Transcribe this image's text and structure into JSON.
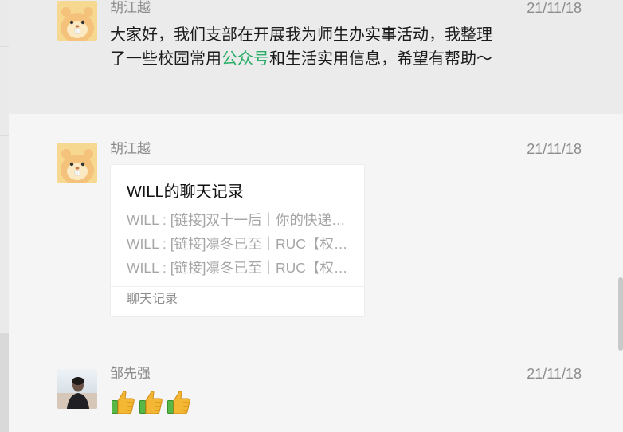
{
  "messages": [
    {
      "sender": "胡江越",
      "time": "21/11/18",
      "avatar": "hamster-avatar",
      "text_parts": [
        "大家好，我们支部在开展我为师生办实事活动，我整理了一些校园常用",
        "公众号",
        "和生活实用信息，希望有帮助～"
      ]
    },
    {
      "sender": "胡江越",
      "time": "21/11/18",
      "avatar": "hamster-avatar",
      "card": {
        "title": "WILL的聊天记录",
        "lines": [
          "WILL : [链接]双十一后｜你的快递…",
          "WILL : [链接]凛冬已至｜RUC【权…",
          "WILL : [链接]凛冬已至｜RUC【权…"
        ],
        "footer": "聊天记录"
      }
    },
    {
      "sender": "邹先强",
      "time": "21/11/18",
      "avatar": "person-photo-avatar",
      "emoji": [
        "thumbs-up-icon",
        "thumbs-up-icon",
        "thumbs-up-icon"
      ]
    }
  ],
  "colors": {
    "link": "#2aae67",
    "meta": "#8c8c8c",
    "selected_bg": "#ebebeb"
  }
}
